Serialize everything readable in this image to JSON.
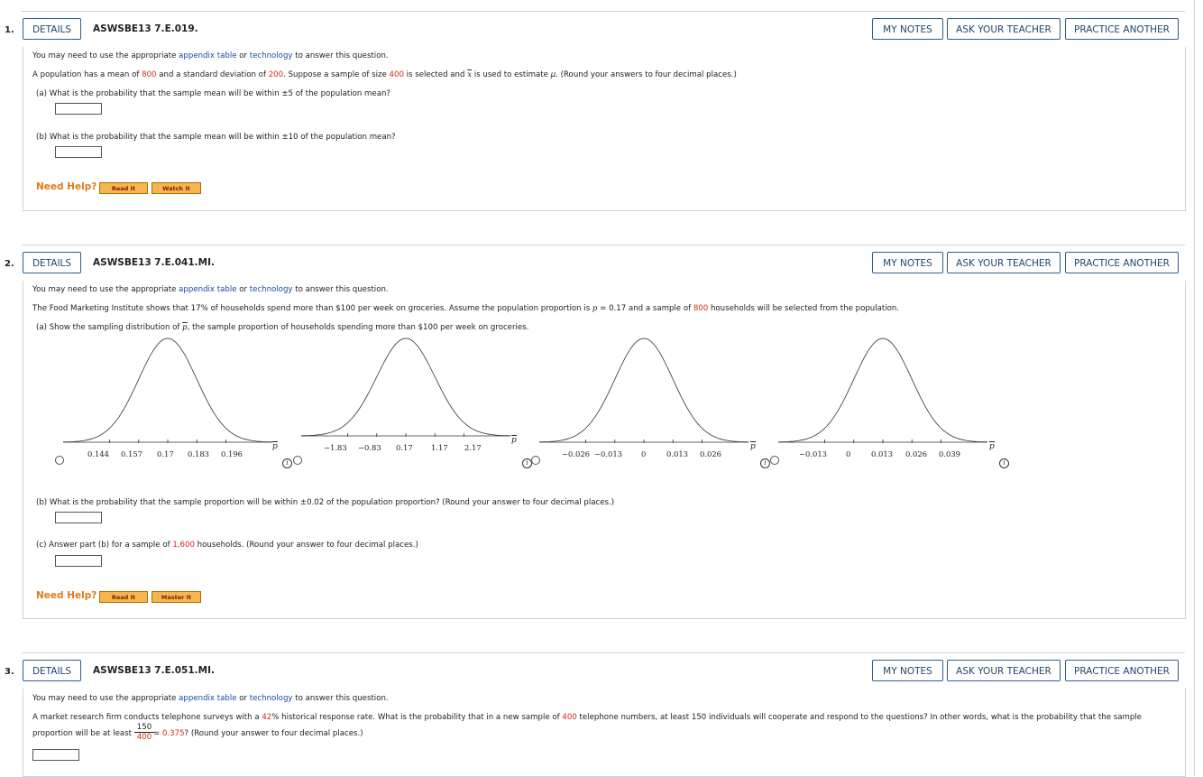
{
  "questions": [
    {
      "number": "1.",
      "details": "DETAILS",
      "id": "ASWSBE13 7.E.019.",
      "my_notes": "MY NOTES",
      "ask_teacher": "ASK YOUR TEACHER",
      "practice": "PRACTICE ANOTHER",
      "intro_pre": "You may need to use the appropriate ",
      "link1": "appendix table",
      "or": " or ",
      "link2": "technology",
      "intro_post": " to answer this question.",
      "stem_a": "A population has a mean of ",
      "mean": "800",
      "stem_b": " and a standard deviation of ",
      "sd": "200",
      "stem_c": ". Suppose a sample of size ",
      "n": "400",
      "stem_d": " is selected and ",
      "xbar": "x",
      "stem_e": " is used to estimate ",
      "mu": "μ",
      "stem_f": ". (Round your answers to four decimal places.)",
      "part_a": "(a)   What is the probability that the sample mean will be within ±5 of the population mean?",
      "part_b": "(b)   What is the probability that the sample mean will be within ±10 of the population mean?",
      "need_help": "Need Help?",
      "help1": "Read It",
      "help2": "Watch It"
    },
    {
      "number": "2.",
      "details": "DETAILS",
      "id": "ASWSBE13 7.E.041.MI.",
      "my_notes": "MY NOTES",
      "ask_teacher": "ASK YOUR TEACHER",
      "practice": "PRACTICE ANOTHER",
      "intro_pre": "You may need to use the appropriate ",
      "link1": "appendix table",
      "or": " or ",
      "link2": "technology",
      "intro_post": " to answer this question.",
      "stem_a": "The Food Marketing Institute shows that 17% of households spend more than $100 per week on groceries. Assume the population proportion is ",
      "p_sym": "p",
      "stem_b": " = 0.17 and a sample of ",
      "n": "800",
      "stem_c": " households will be selected from the population.",
      "part_a_pre": "(a)   Show the sampling distribution of ",
      "pbar": "p",
      "part_a_post": ", the sample proportion of households spending more than $100 per week on groceries.",
      "graphs": [
        {
          "ticks": [
            "0.144",
            "0.157",
            "0.17",
            "0.183",
            "0.196"
          ],
          "axis_label": "p"
        },
        {
          "ticks": [
            "−1.83",
            "−0.83",
            "0.17",
            "1.17",
            "2.17"
          ],
          "axis_label": "p"
        },
        {
          "ticks": [
            "−0.026",
            "−0.013",
            "0",
            "0.013",
            "0.026"
          ],
          "axis_label": "p"
        },
        {
          "ticks": [
            "−0.013",
            "0",
            "0.013",
            "0.026",
            "0.039"
          ],
          "axis_label": "p"
        }
      ],
      "info_glyph": "i",
      "part_b": "(b)   What is the probability that the sample proportion will be within ±0.02 of the population proportion? (Round your answer to four decimal places.)",
      "part_c_pre": "(c)   Answer part (b) for a sample of ",
      "part_c_n": "1,600",
      "part_c_post": " households. (Round your answer to four decimal places.)",
      "need_help": "Need Help?",
      "help1": "Read It",
      "help2": "Master It"
    },
    {
      "number": "3.",
      "details": "DETAILS",
      "id": "ASWSBE13 7.E.051.MI.",
      "my_notes": "MY NOTES",
      "ask_teacher": "ASK YOUR TEACHER",
      "practice": "PRACTICE ANOTHER",
      "intro_pre": "You may need to use the appropriate ",
      "link1": "appendix table",
      "or": " or ",
      "link2": "technology",
      "intro_post": " to answer this question.",
      "stem_a": "A market research firm conducts telephone surveys with a ",
      "rate": "42",
      "stem_b": "% historical response rate. What is the probability that in a new sample of ",
      "n": "400",
      "stem_c": " telephone numbers, at least 150 individuals will cooperate and respond to the questions? In other words, what is the probability that the sample",
      "stem_d": "proportion will be at least ",
      "frac_num": "150",
      "frac_den": "400",
      "eq": " = ",
      "value": "0.375",
      "stem_e": "? (Round your answer to four decimal places.)"
    }
  ]
}
